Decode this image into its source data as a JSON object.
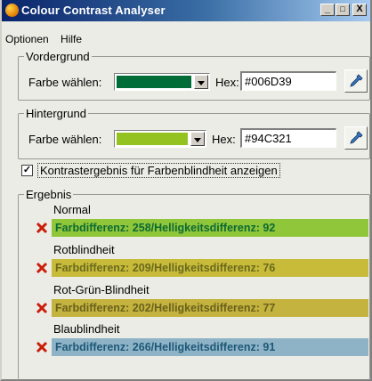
{
  "window": {
    "title": "Colour Contrast Analyser"
  },
  "titlebar_buttons": [
    "_",
    "□",
    "X"
  ],
  "menu": [
    "Optionen",
    "Hilfe"
  ],
  "foreground": {
    "legend": "Vordergrund",
    "color_label": "Farbe wählen:",
    "color": "#006D39",
    "hex_label": "Hex:",
    "hex_value": "#006D39"
  },
  "background": {
    "legend": "Hintergrund",
    "color_label": "Farbe wählen:",
    "color": "#94C321",
    "hex_label": "Hex:",
    "hex_value": "#94C321"
  },
  "colorblind_option": {
    "checked": true,
    "label": "Kontrastergebnis für Farbenblindheit anzeigen"
  },
  "results": {
    "legend": "Ergebnis",
    "items": [
      {
        "name": "Normal",
        "text": "Farbdifferenz: 258/Helligkeitsdifferenz: 92",
        "bg": "#8fc63a",
        "fg": "#0d6a34"
      },
      {
        "name": "Rotblindheit",
        "text": "Farbdifferenz: 209/Helligkeitsdifferenz: 76",
        "bg": "#c8bb3a",
        "fg": "#6a6a1e"
      },
      {
        "name": "Rot-Grün-Blindheit",
        "text": "Farbdifferenz: 202/Helligkeitsdifferenz: 77",
        "bg": "#c4b33e",
        "fg": "#6a611d"
      },
      {
        "name": "Blaublindheit",
        "text": "Farbdifferenz: 266/Helligkeitsdifferenz: 91",
        "bg": "#8fb3c6",
        "fg": "#1d5878"
      }
    ]
  }
}
